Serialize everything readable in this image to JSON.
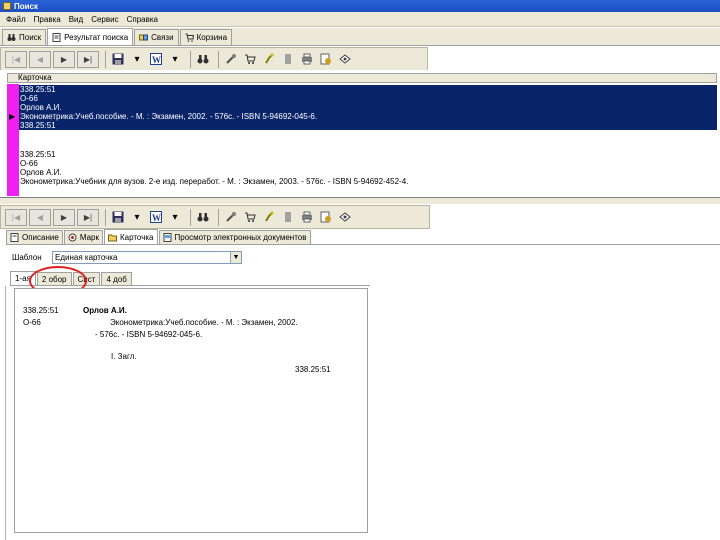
{
  "window": {
    "title": "Поиск"
  },
  "menu": [
    "Файл",
    "Правка",
    "Вид",
    "Сервис",
    "Справка"
  ],
  "main_tabs": [
    {
      "label": "Поиск",
      "icon": "binoculars-icon"
    },
    {
      "label": "Результат поиска",
      "icon": "document-icon"
    },
    {
      "label": "Связи",
      "icon": "links-icon"
    },
    {
      "label": "Корзина",
      "icon": "basket-icon"
    }
  ],
  "grid": {
    "header": "Карточка",
    "records": [
      {
        "lines": [
          "338.25:51",
          "О-66",
          "",
          "Орлов А.И.",
          "     Эконометрика:Учеб.пособие. - М. : Экзамен, 2002. - 576с. - ISBN 5-94692-045-6.",
          " 338.25:51"
        ]
      },
      {
        "lines": [
          "338.25:51",
          "О-66",
          "",
          "Орлов А.И.",
          "     Эконометрика:Учебник для вузов. 2-е изд. переработ. - М. : Экзамен, 2003. - 576с. - ISBN 5-94692-452-4."
        ]
      }
    ]
  },
  "view_tabs": [
    {
      "label": "Описание",
      "icon": "description-icon"
    },
    {
      "label": "Марк",
      "icon": "marc-icon"
    },
    {
      "label": "Карточка",
      "icon": "folder-icon"
    },
    {
      "label": "Просмотр электронных документов",
      "icon": "edoc-icon"
    }
  ],
  "template": {
    "label": "Шаблон",
    "value": "Единая карточка"
  },
  "card_tabs": [
    "1-ая",
    "2 обор",
    "Сист",
    "4 доб"
  ],
  "card": {
    "index": "338.25:51",
    "author_sign": "О-66",
    "author": "Орлов А.И.",
    "desc1": "Эконометрика:Учеб.пособие. - М. : Экзамен, 2002.",
    "desc2": "- 576с. - ISBN 5-94692-045-6.",
    "copies": "I. Загл.",
    "index_bottom": "338.25:51"
  },
  "colors": {
    "selection": "#0a246a",
    "selector": "#f020f0",
    "highlight": "#e02020"
  }
}
